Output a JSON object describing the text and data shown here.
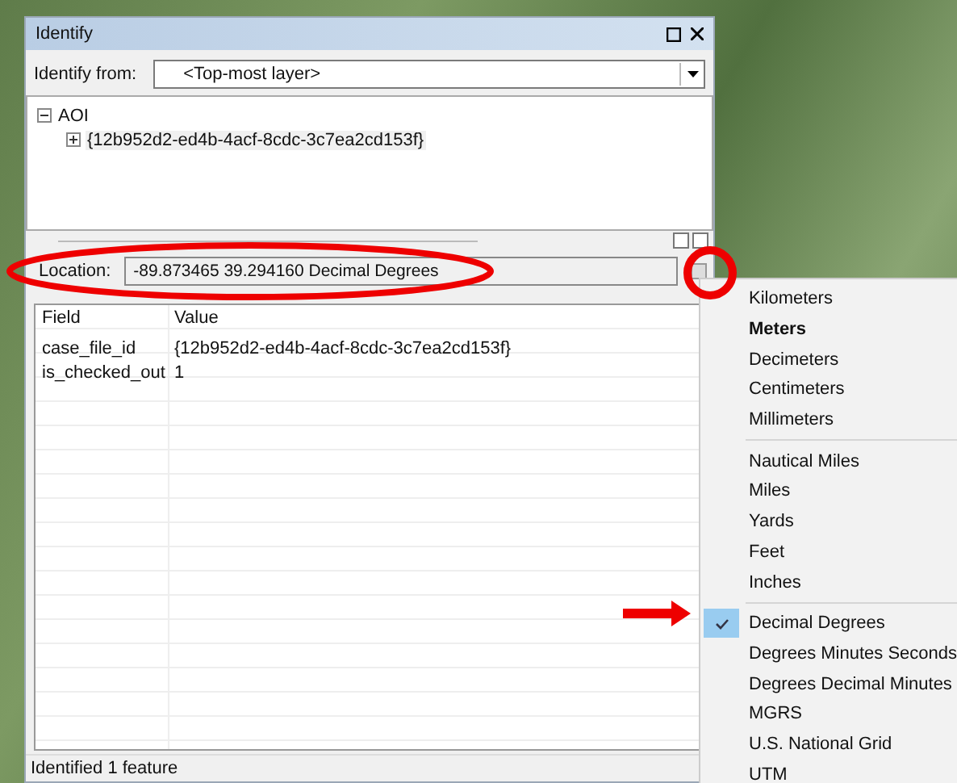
{
  "window": {
    "title": "Identify"
  },
  "identify_from": {
    "label": "Identify from:",
    "value": "<Top-most layer>"
  },
  "tree": [
    {
      "label": "AOI",
      "expanded": true,
      "children": [
        {
          "label": "{12b952d2-ed4b-4acf-8cdc-3c7ea2cd153f}",
          "expanded": false,
          "selected": true
        }
      ]
    }
  ],
  "location": {
    "label": "Location:",
    "value": "-89.873465  39.294160 Decimal Degrees"
  },
  "table": {
    "columns": [
      "Field",
      "Value"
    ],
    "rows": [
      {
        "field": "case_file_id",
        "value": "{12b952d2-ed4b-4acf-8cdc-3c7ea2cd153f}"
      },
      {
        "field": "is_checked_out",
        "value": "1"
      }
    ]
  },
  "status_bar": "Identified 1 feature",
  "units_menu": [
    [
      {
        "label": "Kilometers",
        "bold": false,
        "checked": false
      },
      {
        "label": "Meters",
        "bold": true,
        "checked": false
      },
      {
        "label": "Decimeters",
        "bold": false,
        "checked": false
      },
      {
        "label": "Centimeters",
        "bold": false,
        "checked": false
      },
      {
        "label": "Millimeters",
        "bold": false,
        "checked": false
      }
    ],
    [
      {
        "label": "Nautical Miles",
        "bold": false,
        "checked": false
      },
      {
        "label": "Miles",
        "bold": false,
        "checked": false
      },
      {
        "label": "Yards",
        "bold": false,
        "checked": false
      },
      {
        "label": "Feet",
        "bold": false,
        "checked": false
      },
      {
        "label": "Inches",
        "bold": false,
        "checked": false
      }
    ],
    [
      {
        "label": "Decimal Degrees",
        "bold": false,
        "checked": true
      },
      {
        "label": "Degrees Minutes Seconds",
        "bold": false,
        "checked": false
      },
      {
        "label": "Degrees Decimal Minutes",
        "bold": false,
        "checked": false
      },
      {
        "label": "MGRS",
        "bold": false,
        "checked": false
      },
      {
        "label": "U.S. National Grid",
        "bold": false,
        "checked": false
      },
      {
        "label": "UTM",
        "bold": false,
        "checked": false
      }
    ]
  ]
}
